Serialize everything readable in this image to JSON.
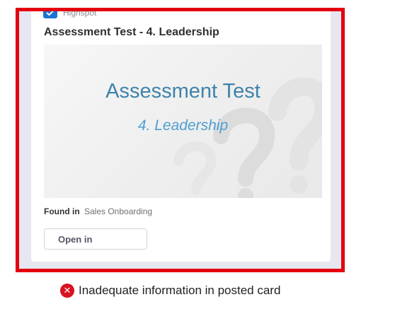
{
  "card": {
    "app_name": "Highspot",
    "app_icon": "check-icon",
    "title": "Assessment Test - 4. Leadership",
    "thumbnail": {
      "title": "Assessment Test",
      "subtitle": "4. Leadership",
      "decoration": "question-marks"
    },
    "found_in_label": "Found in",
    "found_in_value": "Sales Onboarding",
    "open_button_label": "Open in"
  },
  "caption": {
    "icon": "error-x-icon",
    "text": "Inadequate information in posted card"
  },
  "colors": {
    "highlight_border": "#e4000f",
    "frame_background": "#e6e7f1",
    "thumbnail_title": "#3e83ab",
    "thumbnail_subtitle": "#4d9ed1",
    "error_icon": "#d61320",
    "app_icon": "#1b73d3"
  }
}
